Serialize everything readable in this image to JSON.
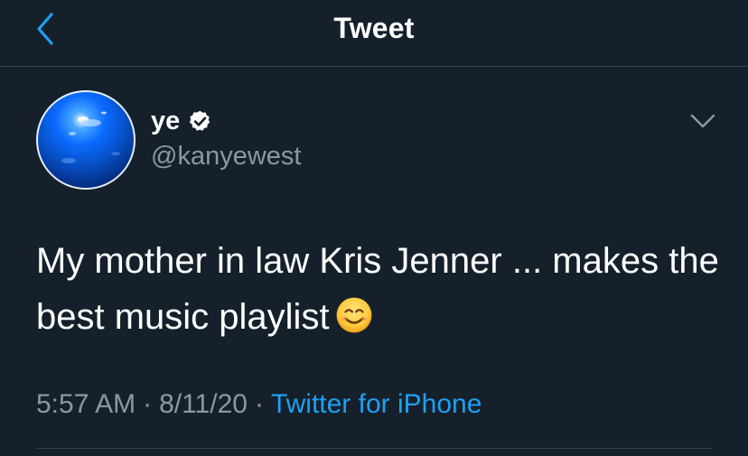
{
  "header": {
    "title": "Tweet",
    "back_icon": "chevron-left-icon"
  },
  "tweet": {
    "display_name": "ye",
    "verified": true,
    "handle": "@kanyewest",
    "text": "My mother in law Kris Jenner ... makes the best music playlist",
    "emoji": "smiling-face-emoji",
    "time": "5:57 AM",
    "date": "8/11/20",
    "separator": "·",
    "source": "Twitter for iPhone"
  },
  "colors": {
    "background": "#15202b",
    "divider": "#38444d",
    "secondary_text": "#8899a6",
    "accent": "#1da1f2"
  }
}
